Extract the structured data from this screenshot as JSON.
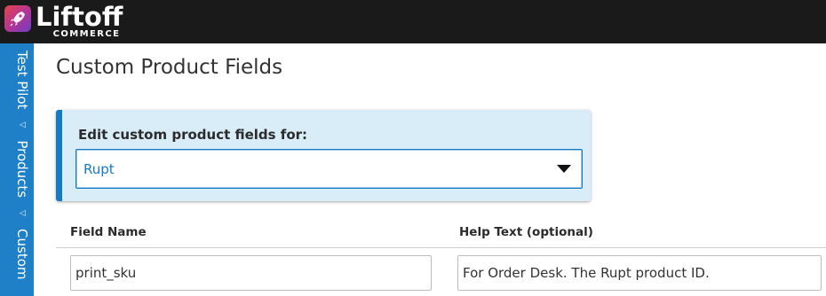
{
  "header": {
    "logo_word": "Liftoff",
    "logo_sub": "COMMERCE",
    "logo_icon": "rocket-icon",
    "brand_colors": [
      "#e8434a",
      "#b0349a",
      "#6a3fc4"
    ]
  },
  "sidebar": {
    "background": "#1f7fc7",
    "breadcrumbs": [
      "Test Pilot",
      "Products",
      "Custom"
    ],
    "separator_icon": "triangle-right-icon"
  },
  "main": {
    "title": "Custom Product Fields",
    "panel": {
      "label": "Edit custom product fields for:",
      "selected_value": "Rupt",
      "accent": "#1679c4"
    },
    "table": {
      "columns": [
        "Field Name",
        "Help Text (optional)"
      ],
      "rows": [
        {
          "field_name": "print_sku",
          "help_text": "For Order Desk. The Rupt product ID."
        }
      ]
    }
  }
}
